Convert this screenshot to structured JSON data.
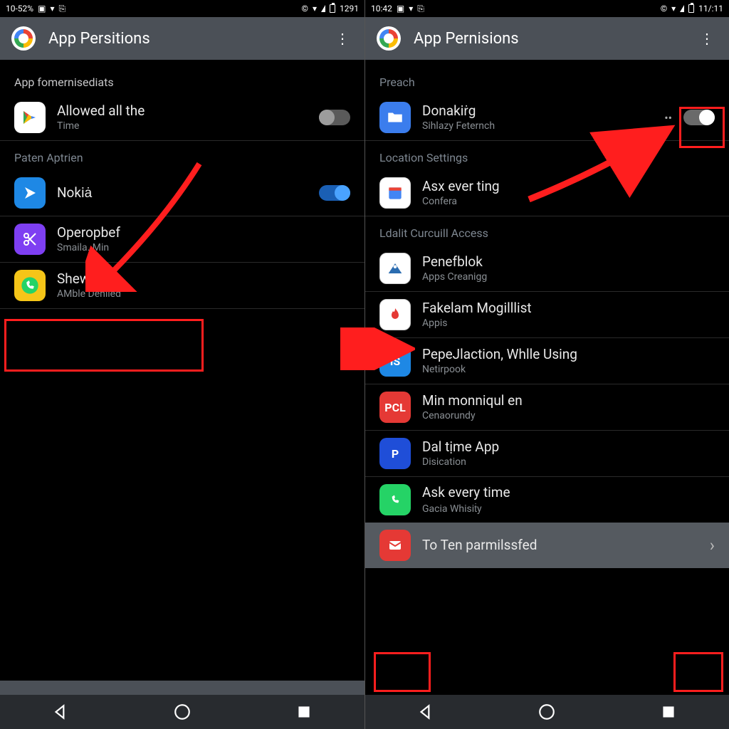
{
  "left": {
    "status": {
      "left_text": "10-52%",
      "time": "1291"
    },
    "app_bar": {
      "title": "App Persitions"
    },
    "section1": {
      "label": "App fomernisediats"
    },
    "row_allowed": {
      "icon": "play-store-icon",
      "primary": "Allowed all the",
      "secondary": "Time"
    },
    "section2": {
      "label": "Paten Aptrien"
    },
    "row_nokia": {
      "icon": "arrow-app-icon",
      "primary": "Nokiȧ"
    },
    "row_opera": {
      "icon": "scissors-app-icon",
      "primary": "Operopbef",
      "secondary": "Smaila. Min"
    },
    "row_shewed": {
      "icon": "whatsapp-yellow-icon",
      "primary": "Shewed",
      "secondary": "AMble Deniied"
    }
  },
  "right": {
    "status": {
      "left_text": "10:42",
      "time": "11/:11"
    },
    "app_bar": {
      "title": "App Pernisions"
    },
    "section1": {
      "label": "Preach"
    },
    "row_don": {
      "icon": "folder-icon",
      "primary": "Donakiṙg",
      "secondary": "Sihlazy Feternch"
    },
    "section2": {
      "label": "Location Settings"
    },
    "row_ask": {
      "icon": "calendar-app-icon",
      "primary": "Asx ever ting",
      "secondary": "Confera"
    },
    "section3": {
      "label": "Ldalit Curcuill Access"
    },
    "row_pen": {
      "icon": "mountain-app-icon",
      "primary": "Penefblok",
      "secondary": "Apps Creanigg"
    },
    "row_fak": {
      "icon": "flame-app-icon",
      "primary": "Fakelam Mogilllist",
      "secondary": "Appis"
    },
    "row_pep": {
      "icon": "is-app-icon",
      "primary": "PepeJlaction, Whlle Using",
      "secondary": "Netirpook"
    },
    "row_min": {
      "icon": "pcl-app-icon",
      "primary": "Min monniqul en",
      "secondary": "Cenaorundy"
    },
    "row_dal": {
      "icon": "p-app-icon",
      "primary": "Dal tịme App",
      "secondary": "Disication"
    },
    "row_ask2": {
      "icon": "whatsapp-icon",
      "primary": "Ask every time",
      "secondary": "Gacia Whisiṫy"
    },
    "row_last": {
      "icon": "mail-app-icon",
      "primary": "To Ten parmilssfed"
    }
  }
}
